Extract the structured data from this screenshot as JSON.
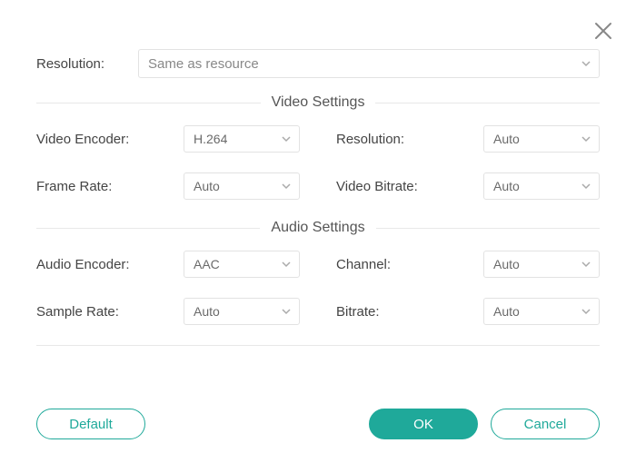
{
  "colors": {
    "accent": "#1fa99a",
    "border": "#e2e2e2"
  },
  "top": {
    "resolution_label": "Resolution:",
    "resolution_value": "Same as resource"
  },
  "video": {
    "section_title": "Video Settings",
    "encoder_label": "Video Encoder:",
    "encoder_value": "H.264",
    "resolution_label": "Resolution:",
    "resolution_value": "Auto",
    "frame_rate_label": "Frame Rate:",
    "frame_rate_value": "Auto",
    "bitrate_label": "Video Bitrate:",
    "bitrate_value": "Auto"
  },
  "audio": {
    "section_title": "Audio Settings",
    "encoder_label": "Audio Encoder:",
    "encoder_value": "AAC",
    "channel_label": "Channel:",
    "channel_value": "Auto",
    "sample_rate_label": "Sample Rate:",
    "sample_rate_value": "Auto",
    "bitrate_label": "Bitrate:",
    "bitrate_value": "Auto"
  },
  "buttons": {
    "default": "Default",
    "ok": "OK",
    "cancel": "Cancel"
  }
}
